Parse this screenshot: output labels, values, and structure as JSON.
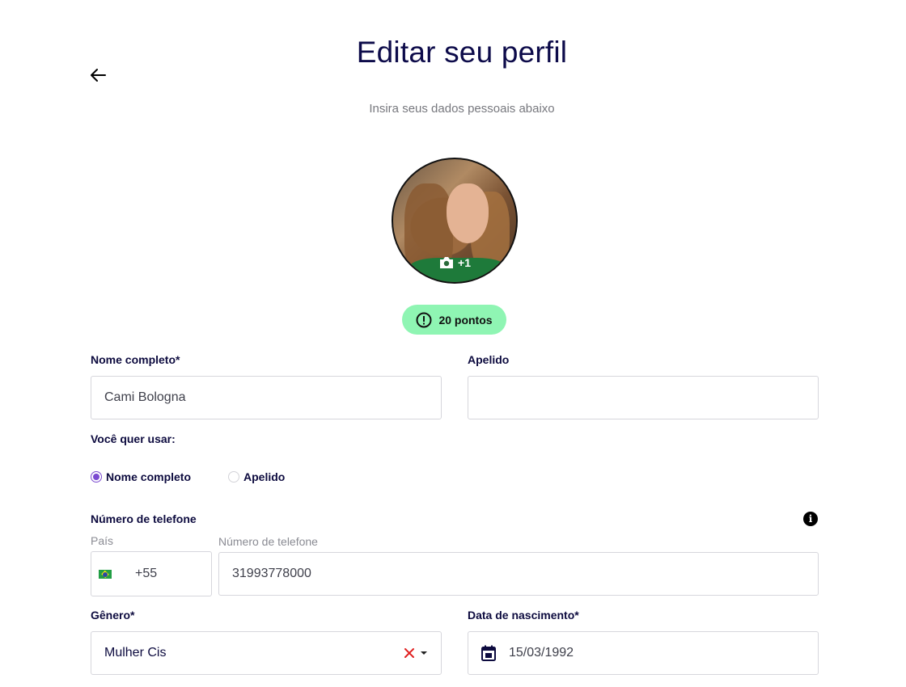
{
  "header": {
    "title": "Editar seu perfil",
    "subtitle": "Insira seus dados pessoais abaixo"
  },
  "avatar": {
    "photo_count_label": "+1"
  },
  "points": {
    "label": "20 pontos",
    "bg_color": "#8ff5b3"
  },
  "form": {
    "full_name": {
      "label": "Nome completo*",
      "value": "Cami Bologna"
    },
    "nickname": {
      "label": "Apelido",
      "value": ""
    },
    "use_preference": {
      "label": "Você quer usar:",
      "options": [
        {
          "label": "Nome completo",
          "checked": true
        },
        {
          "label": "Apelido",
          "checked": false
        }
      ]
    },
    "phone": {
      "label": "Número de telefone",
      "country_label": "País",
      "country_code": "+55",
      "number_label": "Número de telefone",
      "number_value": "31993778000"
    },
    "gender": {
      "label": "Gênero*",
      "value": "Mulher Cis"
    },
    "birthdate": {
      "label": "Data de nascimento*",
      "value": "15/03/1992"
    }
  },
  "colors": {
    "accent": "#7b4ad1",
    "heading": "#0d0b4a",
    "clear_icon": "#e02020"
  }
}
